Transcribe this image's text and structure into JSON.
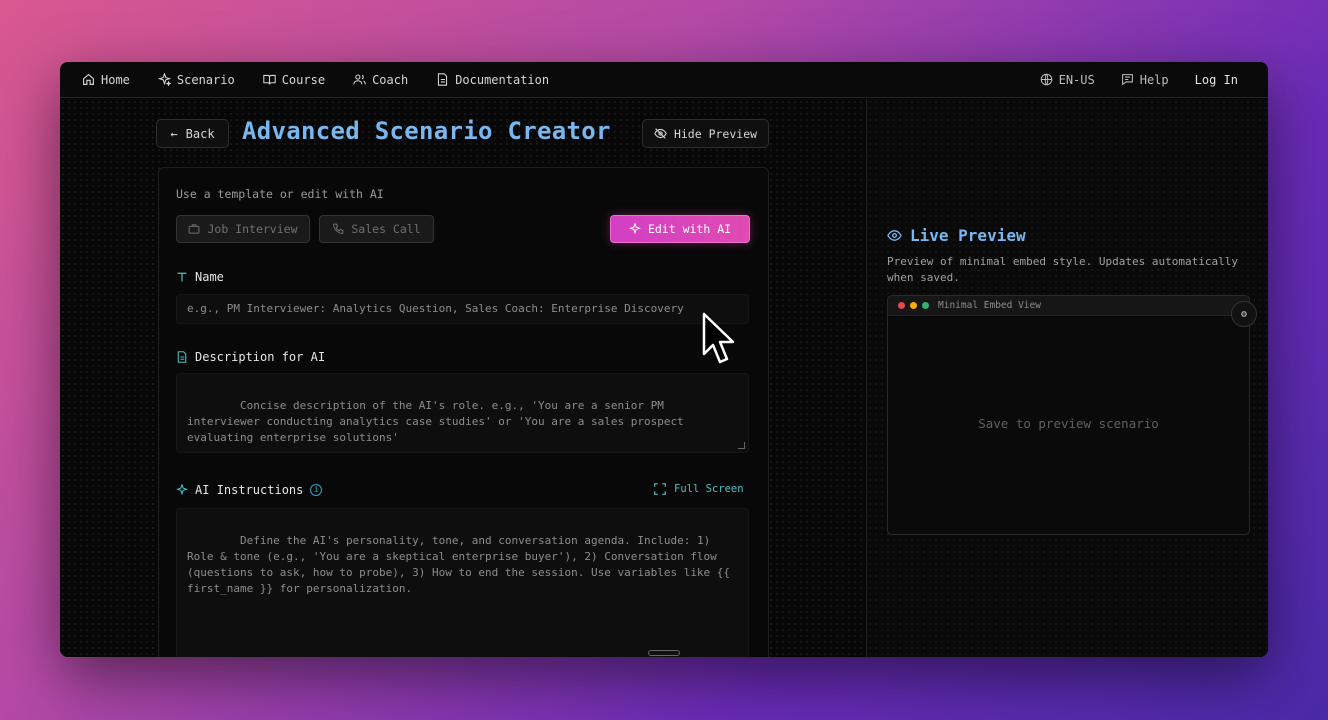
{
  "nav": {
    "items": [
      {
        "label": "Home",
        "icon": "home-icon"
      },
      {
        "label": "Scenario",
        "icon": "sparkle-icon"
      },
      {
        "label": "Course",
        "icon": "book-icon"
      },
      {
        "label": "Coach",
        "icon": "users-icon"
      },
      {
        "label": "Documentation",
        "icon": "document-icon"
      }
    ],
    "language": "EN-US",
    "help": "Help",
    "login": "Log In"
  },
  "header": {
    "back_label": "Back",
    "title": "Advanced Scenario Creator",
    "hide_preview_label": "Hide Preview"
  },
  "templates": {
    "label": "Use a template or edit with AI",
    "job_interview": "Job Interview",
    "sales_call": "Sales Call",
    "edit_ai": "Edit with AI"
  },
  "fields": {
    "name": {
      "label": "Name",
      "placeholder": "e.g., PM Interviewer: Analytics Question, Sales Coach: Enterprise Discovery"
    },
    "description": {
      "label": "Description for AI",
      "placeholder": "Concise description of the AI's role. e.g., 'You are a senior PM interviewer conducting analytics case studies' or 'You are a sales prospect evaluating enterprise solutions'"
    },
    "instructions": {
      "label": "AI Instructions",
      "fullscreen": "Full Screen",
      "placeholder": "Define the AI's personality, tone, and conversation agenda. Include: 1) Role & tone (e.g., 'You are a skeptical enterprise buyer'), 2) Conversation flow (questions to ask, how to probe), 3) How to end the session. Use variables like {{ first_name }} for personalization."
    }
  },
  "preview": {
    "title": "Live Preview",
    "description": "Preview of minimal embed style. Updates automatically when saved.",
    "embed_title": "Minimal Embed View",
    "empty_message": "Save to preview scenario"
  },
  "colors": {
    "accent_blue": "#7ab7ef",
    "accent_pink": "#e04bb1",
    "accent_teal": "#4fc0c4"
  }
}
